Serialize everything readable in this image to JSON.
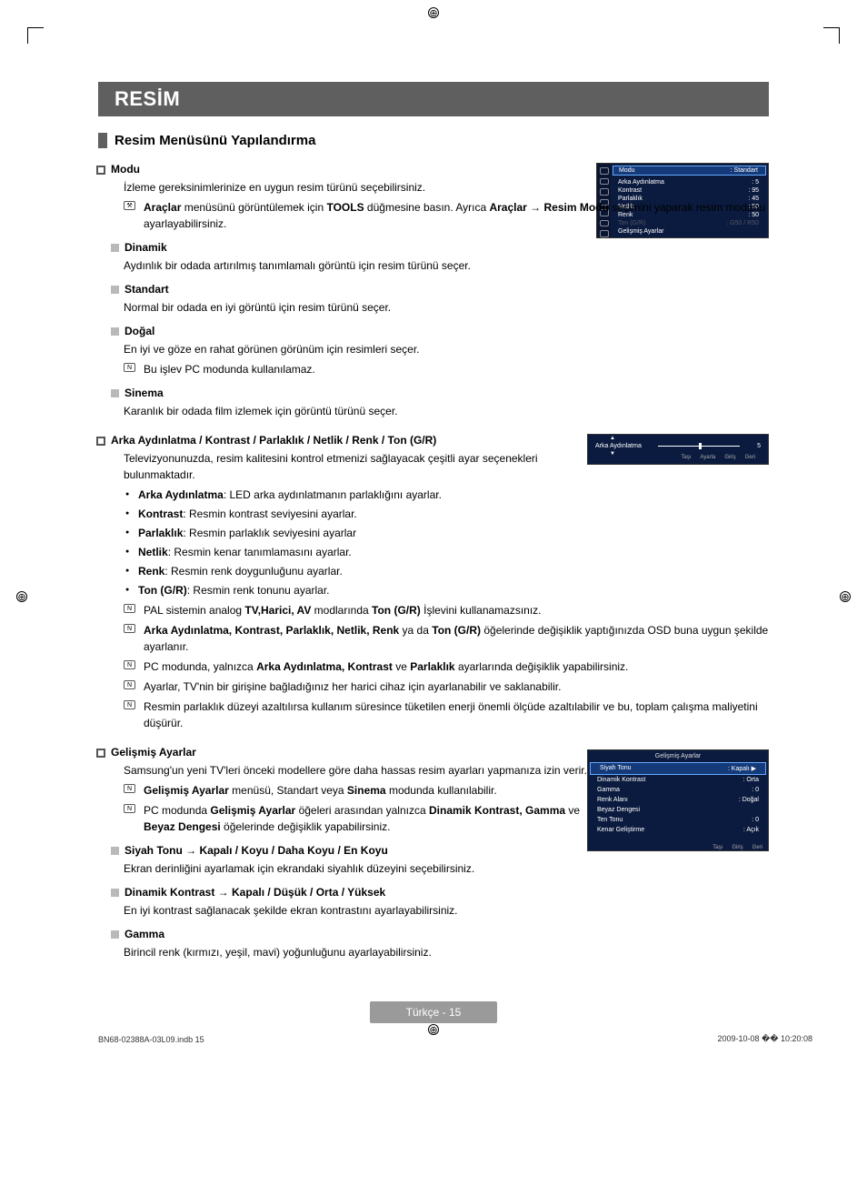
{
  "title": "RESİM",
  "subtitle": "Resim Menüsünü Yapılandırma",
  "footer": "Türkçe - 15",
  "indb": "BN68-02388A-03L09.indb   15",
  "timestamp": "2009-10-08   �� 10:20:08",
  "modu": {
    "h": "Modu",
    "t1": "İzleme gereksinimlerinize en uygun resim türünü seçebilirsiniz.",
    "n1_pre": "Araçlar",
    "n1_mid": " menüsünü görüntülemek için ",
    "n1_tools": "TOOLS",
    "n1_mid2": " düğmesine basın. Ayrıca ",
    "n1_ar": "Araçlar → Resim Modu",
    "n1_end": " seçimini yaparak resim modunu ayarlayabilirsiniz.",
    "dinamik_h": "Dinamik",
    "dinamik_t": "Aydınlık bir odada artırılmış tanımlamalı görüntü için resim türünü seçer.",
    "standart_h": "Standart",
    "standart_t": "Normal bir odada en iyi görüntü için resim türünü seçer.",
    "dogal_h": "Doğal",
    "dogal_t": "En iyi ve göze en rahat görünen görünüm için resimleri seçer.",
    "dogal_n": "Bu işlev PC modunda kullanılamaz.",
    "sinema_h": "Sinema",
    "sinema_t": "Karanlık bir odada film izlemek için görüntü türünü seçer."
  },
  "arka": {
    "h": "Arka Aydınlatma / Kontrast / Parlaklık / Netlik / Renk / Ton (G/R)",
    "t1": "Televizyonunuzda, resim kalitesini kontrol etmenizi sağlayacak çeşitli ayar seçenekleri bulunmaktadır.",
    "b1a": "Arka Aydınlatma",
    "b1b": ": LED arka aydınlatmanın parlaklığını ayarlar.",
    "b2a": "Kontrast",
    "b2b": ": Resmin kontrast seviyesini ayarlar.",
    "b3a": "Parlaklık",
    "b3b": ": Resmin parlaklık seviyesini ayarlar",
    "b4a": "Netlik",
    "b4b": ": Resmin kenar tanımlamasını ayarlar.",
    "b5a": "Renk",
    "b5b": ": Resmin renk doygunluğunu ayarlar.",
    "b6a": "Ton (G/R)",
    "b6b": ": Resmin renk tonunu ayarlar.",
    "n1a": "PAL sistemin analog ",
    "n1b": "TV,Harici, AV",
    "n1c": " modlarında ",
    "n1d": "Ton (G/R)",
    "n1e": " İşlevini kullanamazsınız.",
    "n2a": "Arka Aydınlatma, Kontrast, Parlaklık, Netlik, Renk",
    "n2b": " ya da ",
    "n2c": "Ton (G/R)",
    "n2d": " öğelerinde değişiklik yaptığınızda OSD buna uygun şekilde ayarlanır.",
    "n3a": "PC modunda, yalnızca ",
    "n3b": "Arka Aydınlatma, Kontrast",
    "n3c": " ve ",
    "n3d": "Parlaklık",
    "n3e": " ayarlarında değişiklik yapabilirsiniz.",
    "n4": "Ayarlar, TV'nin bir girişine bağladığınız her harici cihaz için ayarlanabilir ve saklanabilir.",
    "n5": "Resmin parlaklık düzeyi azaltılırsa kullanım süresince tüketilen enerji önemli ölçüde azaltılabilir ve bu, toplam çalışma maliyetini düşürür."
  },
  "gelismis": {
    "h": "Gelişmiş Ayarlar",
    "t1": "Samsung'un yeni TV'leri önceki modellere göre daha hassas resim ayarları yapmanıza izin verir.",
    "n1a": "Gelişmiş Ayarlar",
    "n1b": " menüsü, Standart veya ",
    "n1c": "Sinema",
    "n1d": " modunda kullanılabilir.",
    "n2a": "PC modunda ",
    "n2b": "Gelişmiş Ayarlar",
    "n2c": " öğeleri arasından yalnızca ",
    "n2d": "Dinamik Kontrast, Gamma",
    "n2e": " ve ",
    "n2f": "Beyaz Dengesi",
    "n2g": " öğelerinde değişiklik yapabilirsiniz.",
    "siyah_h": "Siyah Tonu → Kapalı / Koyu / Daha Koyu / En Koyu",
    "siyah_t": "Ekran derinliğini ayarlamak için ekrandaki siyahlık düzeyini seçebilirsiniz.",
    "dkon_h": "Dinamik Kontrast → Kapalı / Düşük / Orta / Yüksek",
    "dkon_t": "En iyi kontrast sağlanacak şekilde ekran kontrastını ayarlayabilirsiniz.",
    "gamma_h": "Gamma",
    "gamma_t": "Birincil renk (kırmızı, yeşil, mavi) yoğunluğunu ayarlayabilirsiniz."
  },
  "osd1": {
    "modu": "Modu",
    "modu_v": ": Standart",
    "r1": "Arka Aydınlatma",
    "v1": ": 5",
    "r2": "Kontrast",
    "v2": ": 95",
    "r3": "Parlaklık",
    "v3": ": 45",
    "r4": "Netlik",
    "v4": ": 50",
    "r5": "Renk",
    "v5": ": 50",
    "r6": "Ton (G/R)",
    "v6": ": G50 / R50",
    "r7": "Gelişmiş Ayarlar"
  },
  "osd2": {
    "label": "Arka Aydınlatma",
    "val": "5",
    "f1": "Taşı",
    "f2": "Ayarla",
    "f3": "Giriş",
    "f4": "Geri"
  },
  "osd3": {
    "ttl": "Gelişmiş Ayarlar",
    "r1": "Siyah Tonu",
    "v1": ": Kapalı",
    "r2": "Dinamik Kontrast",
    "v2": ": Orta",
    "r3": "Gamma",
    "v3": ": 0",
    "r4": "Renk Alanı",
    "v4": ": Doğal",
    "r5": "Beyaz Dengesi",
    "v5": "",
    "r6": "Ten Tonu",
    "v6": ": 0",
    "r7": "Kenar Geliştirme",
    "v7": ": Açık",
    "f1": "Taşı",
    "f2": "Giriş",
    "f3": "Geri"
  }
}
